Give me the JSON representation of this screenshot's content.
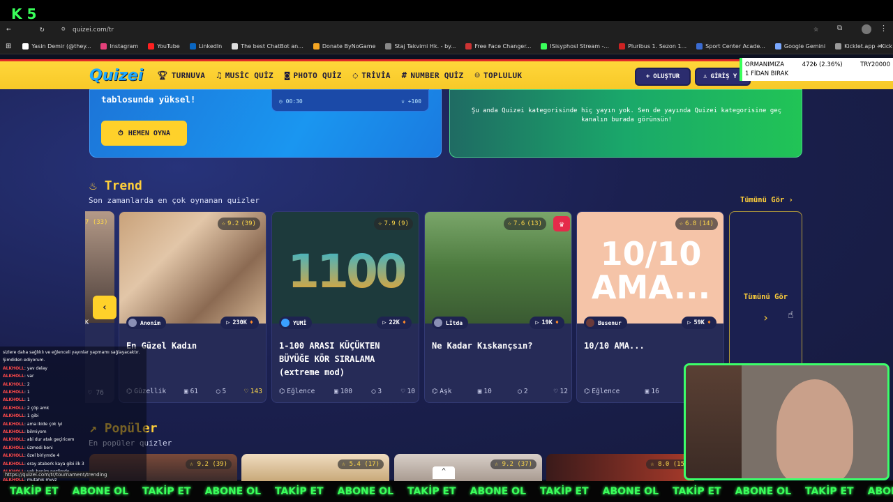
{
  "browser": {
    "url": "quizei.com/tr",
    "status_url": "https://quizei.com/tr/tournament/trending"
  },
  "overlay": {
    "logo": "K 5",
    "ticker_line1": "ORMANIMIZA",
    "ticker_pct": "472₺ (2.36%)",
    "ticker_goal": "TRY20000",
    "ticker_line2": "1 FİDAN BIRAK",
    "banner_items": [
      "TAKİP ET",
      "ABONE OL",
      "TAKİP ET",
      "ABONE OL",
      "TAKİP ET",
      "ABONE OL",
      "TAKİP ET",
      "ABONE OL",
      "TAKİP ET",
      "ABONE OL",
      "TAKİP ET",
      "ABONE OL",
      "TAKİP ET",
      "ABONE OL"
    ]
  },
  "bookmarks": [
    "Yasin Demir (@they...",
    "Instagram",
    "YouTube",
    "LinkedIn",
    "The best ChatBot an...",
    "Donate ByNoGame",
    "Staj Takvimi Hk. - by...",
    "Free Face Changer...",
    "ISisyphosI Stream -...",
    "Pluribus 1. Sezon 1...",
    "Sport Center Acade...",
    "Google Gemini",
    "Kicklet.app - Kick C..."
  ],
  "header": {
    "brand": "Quizei",
    "nav": [
      "TURNUVA",
      "MUSİC QUİZ",
      "PHOTO QUİZ",
      "TRİVİA",
      "NUMBER QUİZ",
      "TOPLULUK"
    ],
    "create": "OLUŞTUR",
    "login": "GİRİŞ Y"
  },
  "hero": {
    "left_text": "tablosunda yüksel!",
    "play": "HEMEN OYNA",
    "timer": "00:30",
    "points": "+100",
    "right_text": "Şu anda Quizei kategorisinde hiç yayın yok. Sen de yayında Quizei kategorisine geç kanalın burada görünsün!"
  },
  "trend": {
    "title": "Trend",
    "subtitle": "Son zamanlarda en çok oynanan quizler",
    "see_all": "Tümünü Gör",
    "see_all_card": "Tümünü Gör",
    "partial_rating": "7 (33)",
    "partial_likes": "76",
    "partial_plays": "K"
  },
  "cards": [
    {
      "rating": "9.2",
      "votes": "(39)",
      "author": "Anonim",
      "plays": "230K",
      "title": "En Güzel Kadın",
      "category": "Güzellik",
      "questions": "61",
      "comments": "5",
      "likes": "143"
    },
    {
      "rating": "7.9",
      "votes": "(9)",
      "author": "YUMİ",
      "plays": "22K",
      "title": "1-100 ARASI KÜÇÜKTEN BÜYÜĞE KÖR SIRALAMA (extreme mod)",
      "category": "Eğlence",
      "questions": "100",
      "comments": "3",
      "likes": "10",
      "image_text": "1100"
    },
    {
      "rating": "7.6",
      "votes": "(13)",
      "author": "Lİtda",
      "plays": "19K",
      "title": "Ne Kadar Kıskançsın?",
      "category": "Aşk",
      "questions": "10",
      "comments": "2",
      "likes": "12"
    },
    {
      "rating": "6.8",
      "votes": "(14)",
      "author": "Busenur",
      "plays": "59K",
      "title": "10/10 AMA...",
      "category": "Eğlence",
      "questions": "16",
      "comments": "2",
      "likes": "",
      "image_text": "10/10 AMA..."
    }
  ],
  "popular": {
    "title": "Popüler",
    "subtitle": "En popüler quizler",
    "ratings": [
      "9.2 (39)",
      "5.4 (17)",
      "9.2 (37)",
      "8.0 (15"
    ]
  },
  "chat": [
    {
      "u": "",
      "m": "sizlere daha sağlıklı ve eğlenceli yayınlar yapmamı sağlayacaktır. Şimdiden ediyorum."
    },
    {
      "u": "ALKHOLL",
      "m": ": yav delay"
    },
    {
      "u": "ALKHOLL",
      "m": ": var"
    },
    {
      "u": "ALKHOLL",
      "m": ": 2"
    },
    {
      "u": "ALKHOLL",
      "m": ": 1"
    },
    {
      "u": "ALKHOLL",
      "m": ": 1"
    },
    {
      "u": "ALKHOLL",
      "m": ": 2 çöp amk"
    },
    {
      "u": "ALKHOLL",
      "m": ": 1 gibi"
    },
    {
      "u": "ALKHOLL",
      "m": ": ama ikide çok iyi"
    },
    {
      "u": "ALKHOLL",
      "m": ": bilmiyom"
    },
    {
      "u": "ALKHOLL",
      "m": ": abi dur atak geçiricem"
    },
    {
      "u": "ALKHOLL",
      "m": ": üzmedi beni"
    },
    {
      "u": "ALKHOLL",
      "m": ": özel biriymde 4"
    },
    {
      "u": "ALKHOLL",
      "m": ": eray ataberk kaya gibi ilk 3"
    },
    {
      "u": "ALKHOLL",
      "m": ": yok benim nezlimde"
    },
    {
      "u": "ALKHOLL",
      "m": ": mutahik myyz"
    }
  ]
}
